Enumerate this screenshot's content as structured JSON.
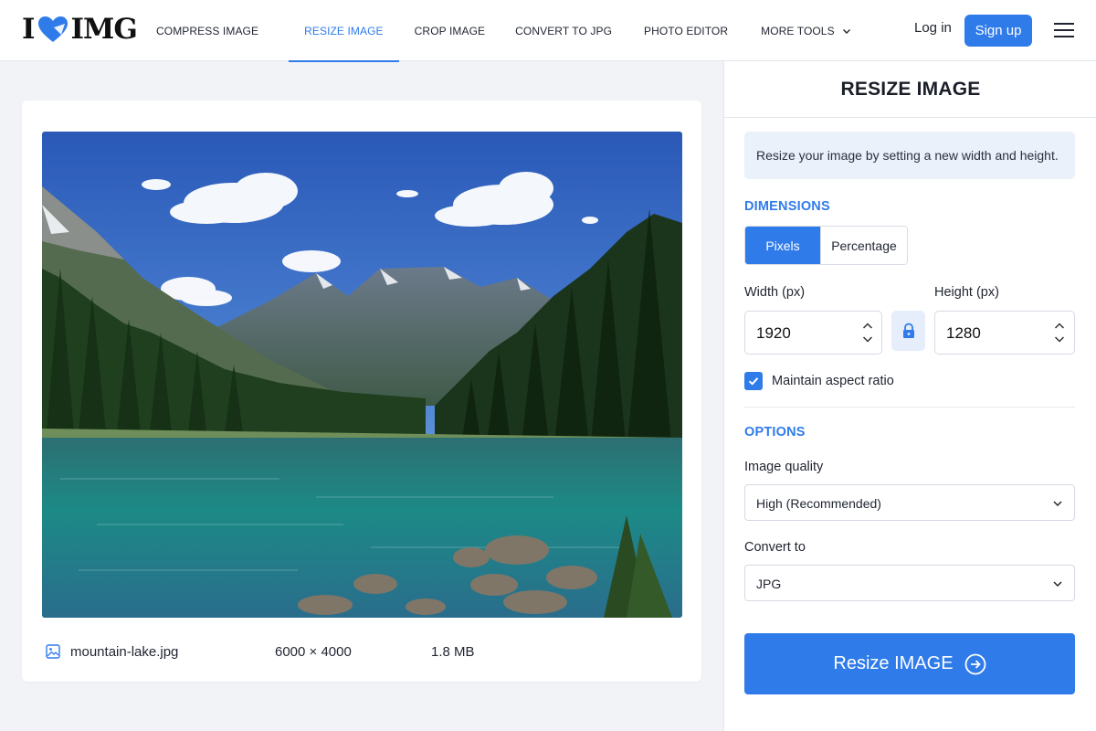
{
  "brand": {
    "logo_left": "I",
    "logo_right": "IMG",
    "accent_color": "#2f7bea"
  },
  "nav": {
    "items": [
      {
        "label": "COMPRESS IMAGE",
        "active": false
      },
      {
        "label": "RESIZE IMAGE",
        "active": true
      },
      {
        "label": "CROP IMAGE",
        "active": false
      },
      {
        "label": "CONVERT TO JPG",
        "active": false
      },
      {
        "label": "PHOTO EDITOR",
        "active": false
      },
      {
        "label": "MORE TOOLS",
        "active": false,
        "icon": "chevron-down-icon"
      }
    ],
    "login_label": "Log in",
    "signup_label": "Sign up",
    "menu_icon": "hamburger-menu-icon"
  },
  "preview": {
    "file_icon": "image-file-icon",
    "file_name": "mountain-lake.jpg",
    "dimensions": "6000 × 4000",
    "file_size": "1.8 MB"
  },
  "panel": {
    "title": "RESIZE IMAGE",
    "info": "Resize your image by setting a new width and height.",
    "dimensions_label": "DIMENSIONS",
    "mode_options": [
      "Pixels",
      "Percentage"
    ],
    "mode_selected": "Pixels",
    "width_label": "Width (px)",
    "width_value": "1920",
    "height_label": "Height (px)",
    "height_value": "1280",
    "lock_icon": "lock-icon",
    "aspect_label": "Maintain aspect ratio",
    "aspect_checked": true,
    "options_label": "OPTIONS",
    "quality_label": "Image quality",
    "quality_value": "High (Recommended)",
    "convert_label": "Convert to",
    "convert_value": "JPG",
    "submit_label": "Resize IMAGE",
    "submit_icon": "arrow-right-circle-icon"
  }
}
